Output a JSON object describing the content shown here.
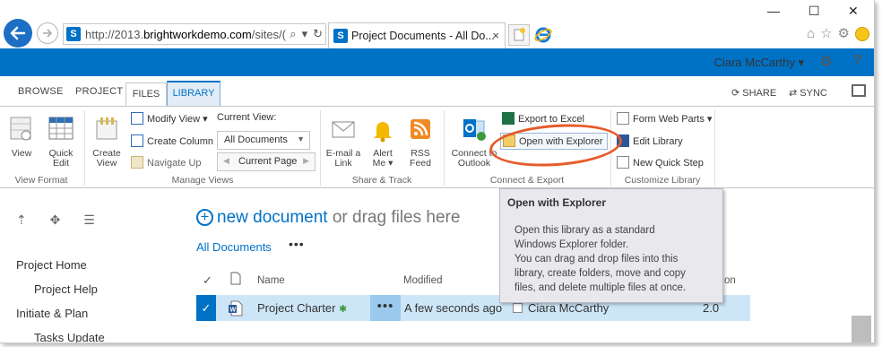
{
  "browser": {
    "url_prefix": "http://2013.",
    "url_domain": "brightworkdemo.com",
    "url_suffix": "/sites/(",
    "tab_title": "Project Documents - All Do...",
    "tab_close": "×",
    "favicon_letter": "S",
    "minimize": "—",
    "maximize": "☐",
    "close": "✕"
  },
  "suite": {
    "user_name": "Ciara McCarthy ▾",
    "brand_color": "#0072c6"
  },
  "ribbon_tabs": {
    "browse": "BROWSE",
    "project": "PROJECT",
    "files": "FILES",
    "library": "LIBRARY",
    "share": "SHARE",
    "sync": "SYNC"
  },
  "ribbon": {
    "view_format": {
      "label": "View Format",
      "view": "View",
      "quick_edit_1": "Quick",
      "quick_edit_2": "Edit"
    },
    "manage_views": {
      "label": "Manage Views",
      "create_view_1": "Create",
      "create_view_2": "View",
      "modify_view": "Modify View ▾",
      "create_column": "Create Column",
      "navigate_up": "Navigate Up",
      "current_view_label": "Current View:",
      "current_view_value": "All Documents",
      "current_page": "Current Page"
    },
    "share_track": {
      "label": "Share & Track",
      "email_1": "E-mail a",
      "email_2": "Link",
      "alert_1": "Alert",
      "alert_2": "Me ▾",
      "rss_1": "RSS",
      "rss_2": "Feed"
    },
    "connect_export": {
      "label": "Connect & Export",
      "connect_1": "Connect to",
      "connect_2": "Outlook",
      "export_excel": "Export to Excel",
      "open_explorer": "Open with Explorer"
    },
    "customize": {
      "label": "Customize Library",
      "form_web_parts": "Form Web Parts ▾",
      "edit_library": "Edit Library",
      "new_quick_step": "New Quick Step"
    }
  },
  "tooltip": {
    "title": "Open with Explorer",
    "line1": "Open this library as a standard",
    "line2": "Windows Explorer folder.",
    "line3": "You can drag and drop files into this",
    "line4": "library, create folders, move and copy",
    "line5": "files, and delete multiple files at once.",
    "callout_color": "#e65b2a"
  },
  "left_nav": {
    "items": [
      "Project Home",
      "Project Help",
      "Initiate & Plan",
      "Tasks Update"
    ]
  },
  "main": {
    "new_document": "new document",
    "or_drag": " or drag files here",
    "view_name": "All Documents",
    "view_more": "•••",
    "columns": {
      "name": "Name",
      "modified": "Modified",
      "version_partial": "on"
    },
    "row": {
      "name": "Project Charter",
      "new_mark": "✱",
      "more": "•••",
      "modified": "A few seconds ago",
      "modified_by": "Ciara McCarthy",
      "version": "2.0"
    }
  }
}
